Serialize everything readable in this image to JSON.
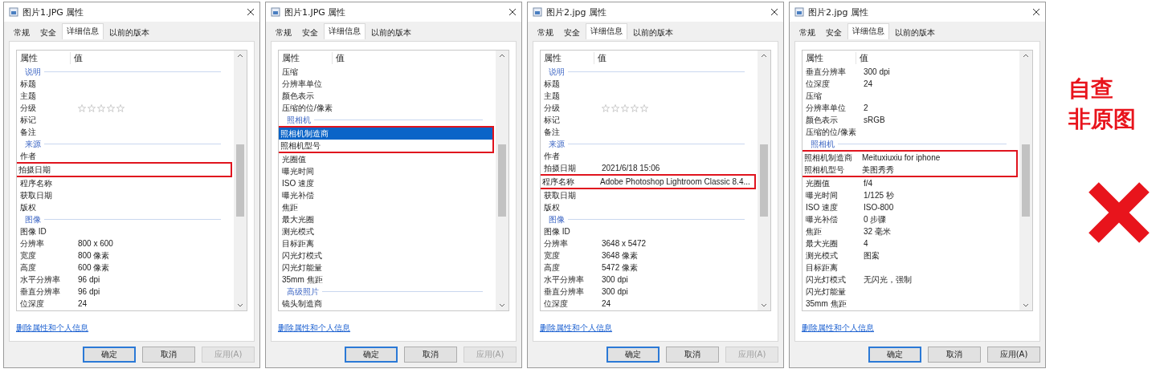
{
  "dialogs": [
    {
      "title": "图片1.JPG 属性",
      "tabs": [
        {
          "label": "常规",
          "selected": false
        },
        {
          "label": "安全",
          "selected": false
        },
        {
          "label": "详细信息",
          "selected": true
        },
        {
          "label": "以前的版本",
          "selected": false
        }
      ],
      "columns": [
        "属性",
        "值"
      ],
      "rows": [
        {
          "kind": "section",
          "name": "说明"
        },
        {
          "kind": "row",
          "name": "标题",
          "selected": false,
          "marked": false
        },
        {
          "kind": "row",
          "name": "主题",
          "selected": false,
          "marked": false
        },
        {
          "kind": "stars",
          "name": "分级",
          "stars": 0,
          "selected": false,
          "marked": false
        },
        {
          "kind": "row",
          "name": "标记",
          "selected": false,
          "marked": false
        },
        {
          "kind": "row",
          "name": "备注",
          "selected": false,
          "marked": false
        },
        {
          "kind": "section",
          "name": "来源"
        },
        {
          "kind": "row",
          "name": "作者",
          "selected": false,
          "marked": false
        },
        {
          "kind": "row",
          "name": "拍摄日期",
          "selected": false,
          "marked": true
        },
        {
          "kind": "row",
          "name": "程序名称",
          "selected": false,
          "marked": false
        },
        {
          "kind": "row",
          "name": "获取日期",
          "selected": false,
          "marked": false
        },
        {
          "kind": "row",
          "name": "版权",
          "selected": false,
          "marked": false
        },
        {
          "kind": "section",
          "name": "图像"
        },
        {
          "kind": "row",
          "name": "图像 ID",
          "selected": false,
          "marked": false
        },
        {
          "kind": "row",
          "name": "分辨率",
          "value": "800 x 600",
          "selected": false,
          "marked": false
        },
        {
          "kind": "row",
          "name": "宽度",
          "value": "800 像素",
          "selected": false,
          "marked": false
        },
        {
          "kind": "row",
          "name": "高度",
          "value": "600 像素",
          "selected": false,
          "marked": false
        },
        {
          "kind": "row",
          "name": "水平分辨率",
          "value": "96 dpi",
          "selected": false,
          "marked": false
        },
        {
          "kind": "row",
          "name": "垂直分辨率",
          "value": "96 dpi",
          "selected": false,
          "marked": false
        },
        {
          "kind": "row",
          "name": "位深度",
          "value": "24",
          "selected": false,
          "marked": false
        }
      ],
      "link": "删除属性和个人信息",
      "buttons": [
        {
          "label": "确定",
          "default": true,
          "disabled": false
        },
        {
          "label": "取消",
          "default": false,
          "disabled": false
        },
        {
          "label": "应用(A)",
          "default": false,
          "disabled": true
        }
      ]
    },
    {
      "title": "图片1.JPG 属性",
      "tabs": [
        {
          "label": "常规",
          "selected": false
        },
        {
          "label": "安全",
          "selected": false
        },
        {
          "label": "详细信息",
          "selected": true
        },
        {
          "label": "以前的版本",
          "selected": false
        }
      ],
      "columns": [
        "属性",
        "值"
      ],
      "rows": [
        {
          "kind": "row",
          "name": "压缩",
          "selected": false,
          "marked": false
        },
        {
          "kind": "row",
          "name": "分辨率单位",
          "selected": false,
          "marked": false
        },
        {
          "kind": "row",
          "name": "颜色表示",
          "selected": false,
          "marked": false
        },
        {
          "kind": "row",
          "name": "压缩的位/像素",
          "selected": false,
          "marked": false
        },
        {
          "kind": "section",
          "name": "照相机"
        },
        {
          "kind": "row",
          "name": "照相机制造商",
          "selected": true,
          "marked": true
        },
        {
          "kind": "row",
          "name": "照相机型号",
          "selected": false,
          "marked": true
        },
        {
          "kind": "row",
          "name": "光圈值",
          "selected": false,
          "marked": false
        },
        {
          "kind": "row",
          "name": "曝光时间",
          "selected": false,
          "marked": false
        },
        {
          "kind": "row",
          "name": "ISO 速度",
          "selected": false,
          "marked": false
        },
        {
          "kind": "row",
          "name": "曝光补偿",
          "selected": false,
          "marked": false
        },
        {
          "kind": "row",
          "name": "焦距",
          "selected": false,
          "marked": false
        },
        {
          "kind": "row",
          "name": "最大光圈",
          "selected": false,
          "marked": false
        },
        {
          "kind": "row",
          "name": "测光模式",
          "selected": false,
          "marked": false
        },
        {
          "kind": "row",
          "name": "目标距离",
          "selected": false,
          "marked": false
        },
        {
          "kind": "row",
          "name": "闪光灯模式",
          "selected": false,
          "marked": false
        },
        {
          "kind": "row",
          "name": "闪光灯能量",
          "selected": false,
          "marked": false
        },
        {
          "kind": "row",
          "name": "35mm 焦距",
          "selected": false,
          "marked": false
        },
        {
          "kind": "section",
          "name": "高级照片"
        },
        {
          "kind": "row",
          "name": "镜头制造商",
          "selected": false,
          "marked": false
        }
      ],
      "link": "删除属性和个人信息",
      "buttons": [
        {
          "label": "确定",
          "default": true,
          "disabled": false
        },
        {
          "label": "取消",
          "default": false,
          "disabled": false
        },
        {
          "label": "应用(A)",
          "default": false,
          "disabled": true
        }
      ]
    },
    {
      "title": "图片2.jpg 属性",
      "tabs": [
        {
          "label": "常规",
          "selected": false
        },
        {
          "label": "安全",
          "selected": false
        },
        {
          "label": "详细信息",
          "selected": true
        },
        {
          "label": "以前的版本",
          "selected": false
        }
      ],
      "columns": [
        "属性",
        "值"
      ],
      "rows": [
        {
          "kind": "section",
          "name": "说明"
        },
        {
          "kind": "row",
          "name": "标题",
          "selected": false,
          "marked": false
        },
        {
          "kind": "row",
          "name": "主题",
          "selected": false,
          "marked": false
        },
        {
          "kind": "stars",
          "name": "分级",
          "stars": 0,
          "selected": false,
          "marked": false
        },
        {
          "kind": "row",
          "name": "标记",
          "selected": false,
          "marked": false
        },
        {
          "kind": "row",
          "name": "备注",
          "selected": false,
          "marked": false
        },
        {
          "kind": "section",
          "name": "来源"
        },
        {
          "kind": "row",
          "name": "作者",
          "selected": false,
          "marked": false
        },
        {
          "kind": "row",
          "name": "拍摄日期",
          "value": "2021/6/18 15:06",
          "selected": false,
          "marked": false
        },
        {
          "kind": "row",
          "name": "程序名称",
          "value": "Adobe Photoshop Lightroom Classic 8.4...",
          "selected": false,
          "marked": true
        },
        {
          "kind": "row",
          "name": "获取日期",
          "selected": false,
          "marked": false
        },
        {
          "kind": "row",
          "name": "版权",
          "selected": false,
          "marked": false
        },
        {
          "kind": "section",
          "name": "图像"
        },
        {
          "kind": "row",
          "name": "图像 ID",
          "selected": false,
          "marked": false
        },
        {
          "kind": "row",
          "name": "分辨率",
          "value": "3648 x 5472",
          "selected": false,
          "marked": false
        },
        {
          "kind": "row",
          "name": "宽度",
          "value": "3648 像素",
          "selected": false,
          "marked": false
        },
        {
          "kind": "row",
          "name": "高度",
          "value": "5472 像素",
          "selected": false,
          "marked": false
        },
        {
          "kind": "row",
          "name": "水平分辨率",
          "value": "300 dpi",
          "selected": false,
          "marked": false
        },
        {
          "kind": "row",
          "name": "垂直分辨率",
          "value": "300 dpi",
          "selected": false,
          "marked": false
        },
        {
          "kind": "row",
          "name": "位深度",
          "value": "24",
          "selected": false,
          "marked": false
        }
      ],
      "link": "删除属性和个人信息",
      "buttons": [
        {
          "label": "确定",
          "default": true,
          "disabled": false
        },
        {
          "label": "取消",
          "default": false,
          "disabled": false
        },
        {
          "label": "应用(A)",
          "default": false,
          "disabled": true
        }
      ]
    },
    {
      "title": "图片2.jpg 属性",
      "tabs": [
        {
          "label": "常规",
          "selected": false
        },
        {
          "label": "安全",
          "selected": false
        },
        {
          "label": "详细信息",
          "selected": true
        },
        {
          "label": "以前的版本",
          "selected": false
        }
      ],
      "columns": [
        "属性",
        "值"
      ],
      "rows": [
        {
          "kind": "row",
          "name": "垂直分辨率",
          "value": "300 dpi",
          "selected": false,
          "marked": false
        },
        {
          "kind": "row",
          "name": "位深度",
          "value": "24",
          "selected": false,
          "marked": false
        },
        {
          "kind": "row",
          "name": "压缩",
          "selected": false,
          "marked": false
        },
        {
          "kind": "row",
          "name": "分辨率单位",
          "value": "2",
          "selected": false,
          "marked": false
        },
        {
          "kind": "row",
          "name": "颜色表示",
          "value": "sRGB",
          "selected": false,
          "marked": false
        },
        {
          "kind": "row",
          "name": "压缩的位/像素",
          "selected": false,
          "marked": false
        },
        {
          "kind": "section",
          "name": "照相机"
        },
        {
          "kind": "row",
          "name": "照相机制造商",
          "value": "Meituxiuxiu for iphone",
          "selected": false,
          "marked": true
        },
        {
          "kind": "row",
          "name": "照相机型号",
          "value": "美图秀秀",
          "selected": false,
          "marked": true
        },
        {
          "kind": "row",
          "name": "光圈值",
          "value": "f/4",
          "selected": false,
          "marked": false
        },
        {
          "kind": "row",
          "name": "曝光时间",
          "value": "1/125 秒",
          "selected": false,
          "marked": false
        },
        {
          "kind": "row",
          "name": "ISO 速度",
          "value": "ISO-800",
          "selected": false,
          "marked": false
        },
        {
          "kind": "row",
          "name": "曝光补偿",
          "value": "0 步骤",
          "selected": false,
          "marked": false
        },
        {
          "kind": "row",
          "name": "焦距",
          "value": "32 毫米",
          "selected": false,
          "marked": false
        },
        {
          "kind": "row",
          "name": "最大光圈",
          "value": "4",
          "selected": false,
          "marked": false
        },
        {
          "kind": "row",
          "name": "测光模式",
          "value": "图案",
          "selected": false,
          "marked": false
        },
        {
          "kind": "row",
          "name": "目标距离",
          "selected": false,
          "marked": false
        },
        {
          "kind": "row",
          "name": "闪光灯模式",
          "value": "无闪光，强制",
          "selected": false,
          "marked": false
        },
        {
          "kind": "row",
          "name": "闪光灯能量",
          "selected": false,
          "marked": false
        },
        {
          "kind": "row",
          "name": "35mm 焦距",
          "selected": false,
          "marked": false
        }
      ],
      "link": "删除属性和个人信息",
      "buttons": [
        {
          "label": "确定",
          "default": true,
          "disabled": false
        },
        {
          "label": "取消",
          "default": false,
          "disabled": false
        },
        {
          "label": "应用(A)",
          "default": false,
          "disabled": false
        }
      ]
    }
  ],
  "annotation": {
    "lines": [
      "自查",
      "非原图"
    ],
    "rejected": true
  }
}
